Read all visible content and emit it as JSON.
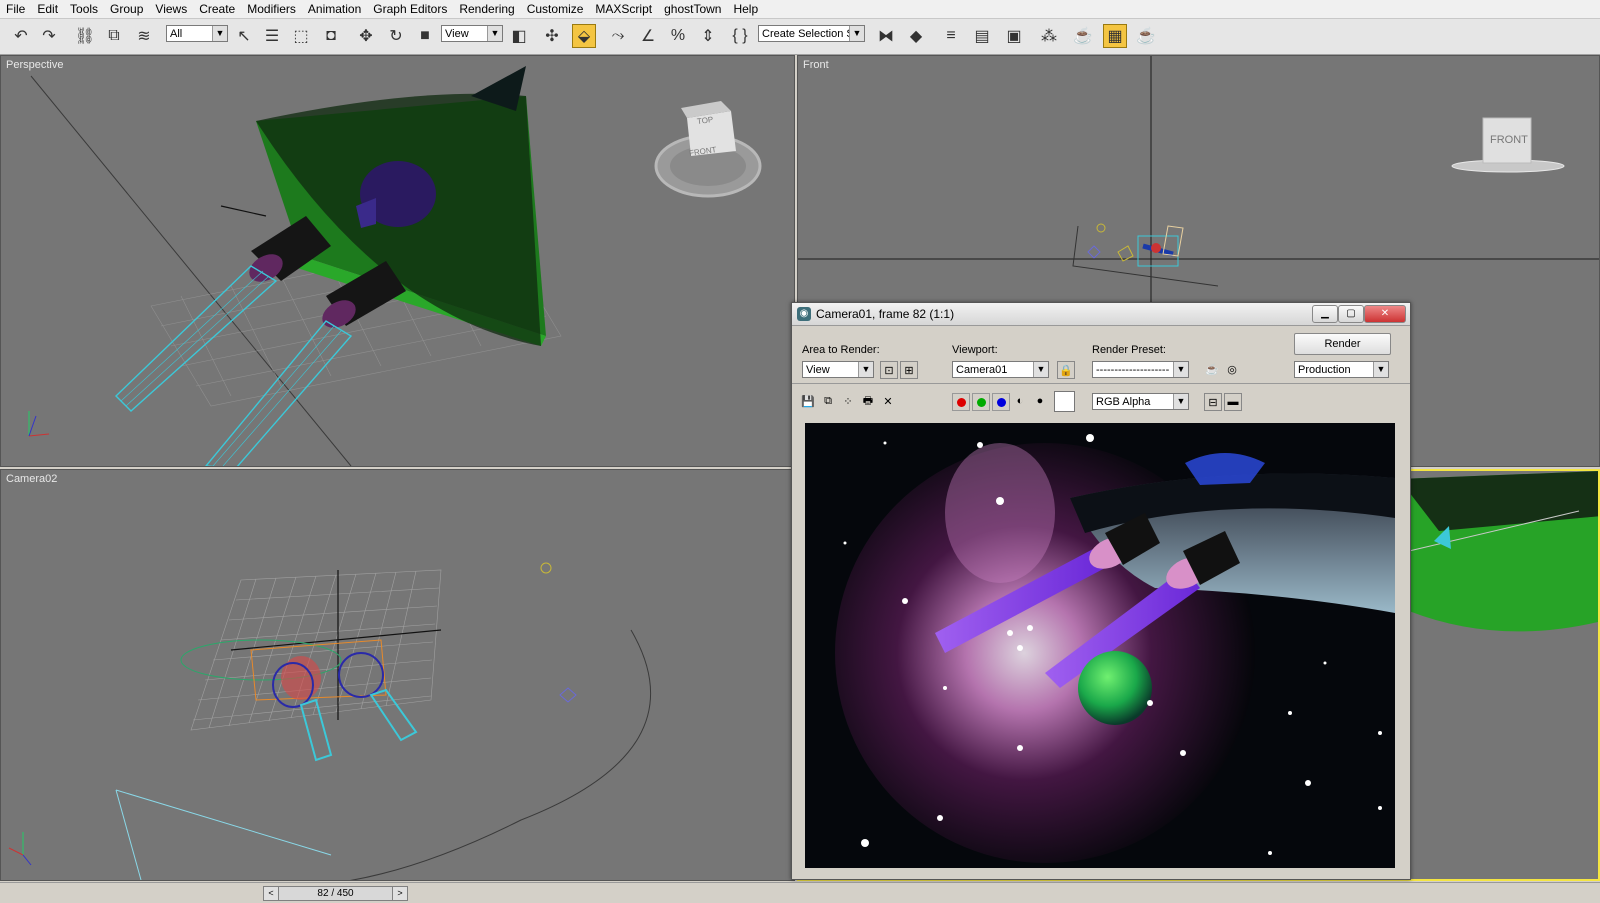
{
  "menu": [
    "File",
    "Edit",
    "Tools",
    "Group",
    "Views",
    "Create",
    "Modifiers",
    "Animation",
    "Graph Editors",
    "Rendering",
    "Customize",
    "MAXScript",
    "ghostTown",
    "Help"
  ],
  "toolbar": {
    "selection_filter": "All",
    "ref_coord": "View",
    "named_selection_placeholder": "Create Selection Set"
  },
  "viewports": {
    "perspective": "Perspective",
    "front": "Front",
    "camera02": "Camera02",
    "front_cube_label": "FRONT",
    "persp_cube_top": "TOP",
    "persp_cube_front": "FRONT"
  },
  "timeline": {
    "frame_display": "82 / 450",
    "prev": "<",
    "next": ">"
  },
  "render_window": {
    "title": "Camera01, frame 82 (1:1)",
    "area_label": "Area to Render:",
    "area_value": "View",
    "viewport_label": "Viewport:",
    "viewport_value": "Camera01",
    "preset_label": "Render Preset:",
    "preset_value": "--------------------",
    "render_button": "Render",
    "mode_value": "Production",
    "channel_value": "RGB Alpha"
  },
  "colors": {
    "viewport_bg": "#767676",
    "highlight": "#f4e542",
    "ship_green": "#27a327",
    "beam_cyan": "#3cc8d8"
  }
}
